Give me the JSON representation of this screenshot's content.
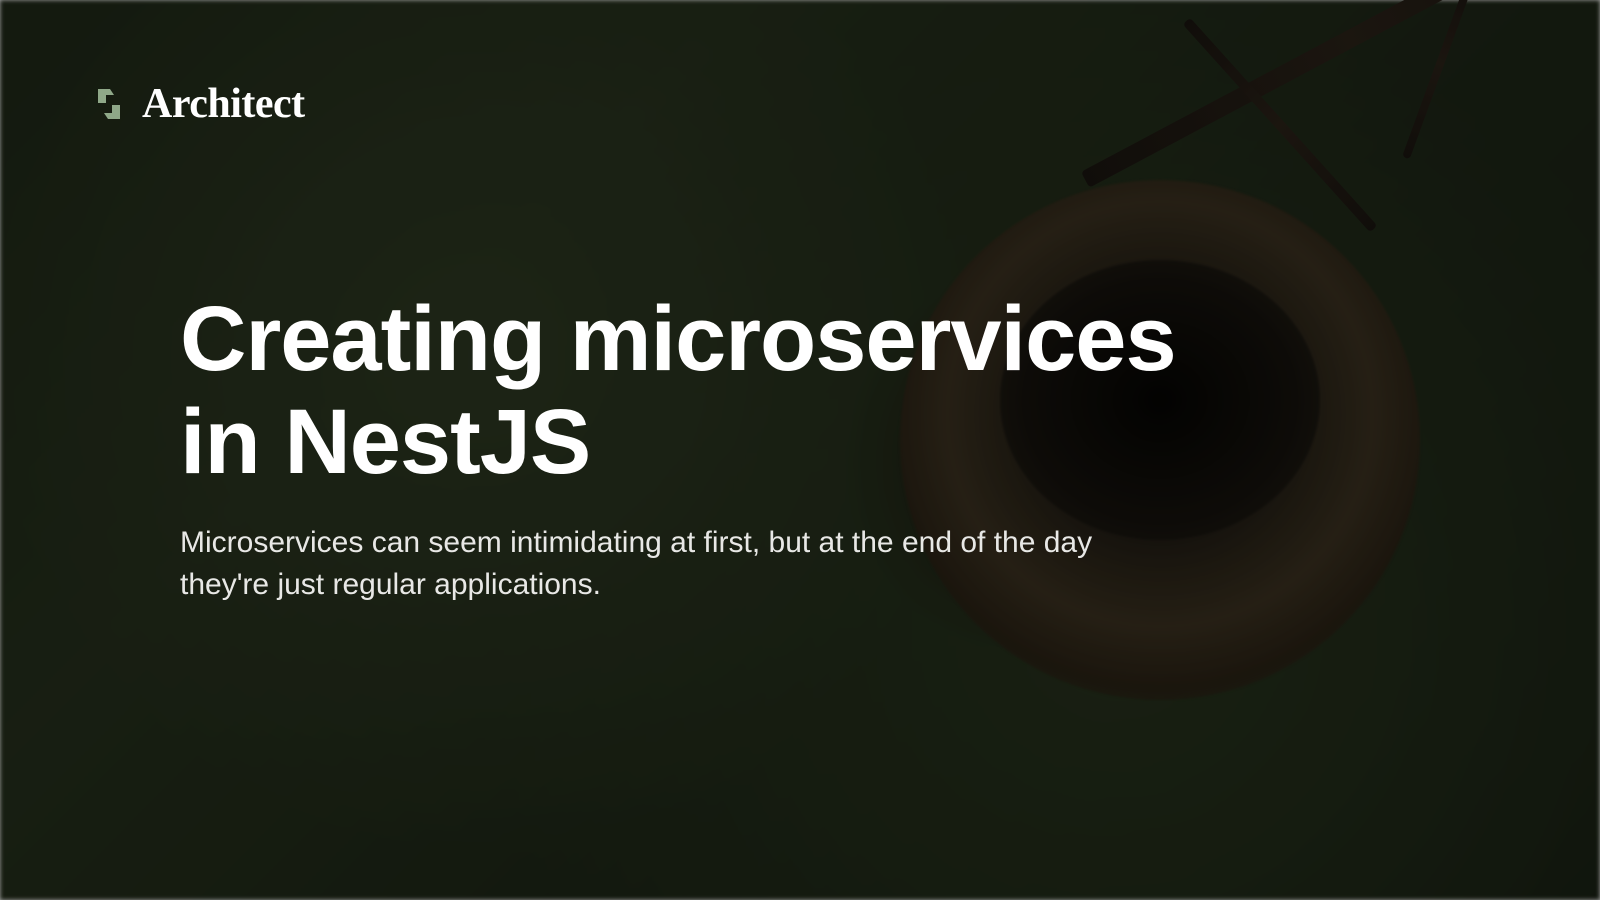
{
  "logo": {
    "name": "Architect",
    "icon_color": "#8fa888"
  },
  "hero": {
    "title": "Creating microservices in NestJS",
    "subtitle": "Microservices can seem intimidating at first, but at the end of the day they're just regular applications."
  }
}
